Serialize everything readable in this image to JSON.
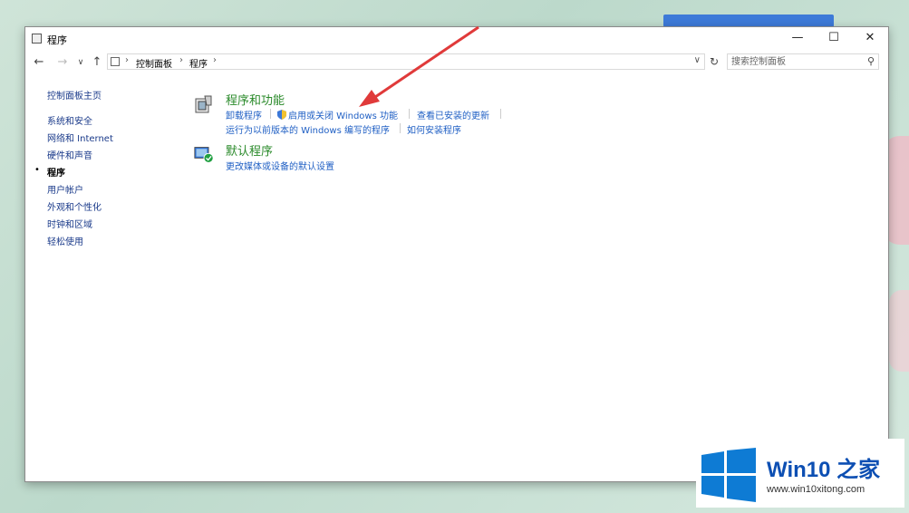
{
  "window": {
    "title": "程序",
    "controls": {
      "minimize": "—",
      "maximize": "☐",
      "close": "✕"
    }
  },
  "nav": {
    "back": "←",
    "forward": "→",
    "recent": "∨",
    "up": "↑",
    "refresh": "↻",
    "dropdown": "∨"
  },
  "address": {
    "crumbs": [
      "控制面板",
      "程序"
    ],
    "separator": "›"
  },
  "search": {
    "placeholder": "搜索控制面板"
  },
  "left_nav": {
    "home": "控制面板主页",
    "items": [
      "系统和安全",
      "网络和 Internet",
      "硬件和声音",
      "程序",
      "用户帐户",
      "外观和个性化",
      "时钟和区域",
      "轻松使用"
    ],
    "current_index": 3,
    "bullet": "•"
  },
  "categories": [
    {
      "title": "程序和功能",
      "icon": "programs-features-icon",
      "tasks_row1": [
        "卸载程序",
        "启用或关闭 Windows 功能",
        "查看已安装的更新"
      ],
      "tasks_row2": [
        "运行为以前版本的 Windows 编写的程序",
        "如何安装程序"
      ]
    },
    {
      "title": "默认程序",
      "icon": "default-programs-icon",
      "tasks_row1": [
        "更改媒体或设备的默认设置"
      ]
    }
  ],
  "watermark": {
    "brand": "Win10 之家",
    "url": "www.win10xitong.com"
  },
  "colors": {
    "category_title": "#2a8a2a",
    "task_link": "#1f5fc4",
    "annotation_arrow": "#e03a3a",
    "brand_blue": "#0d4fb3"
  }
}
